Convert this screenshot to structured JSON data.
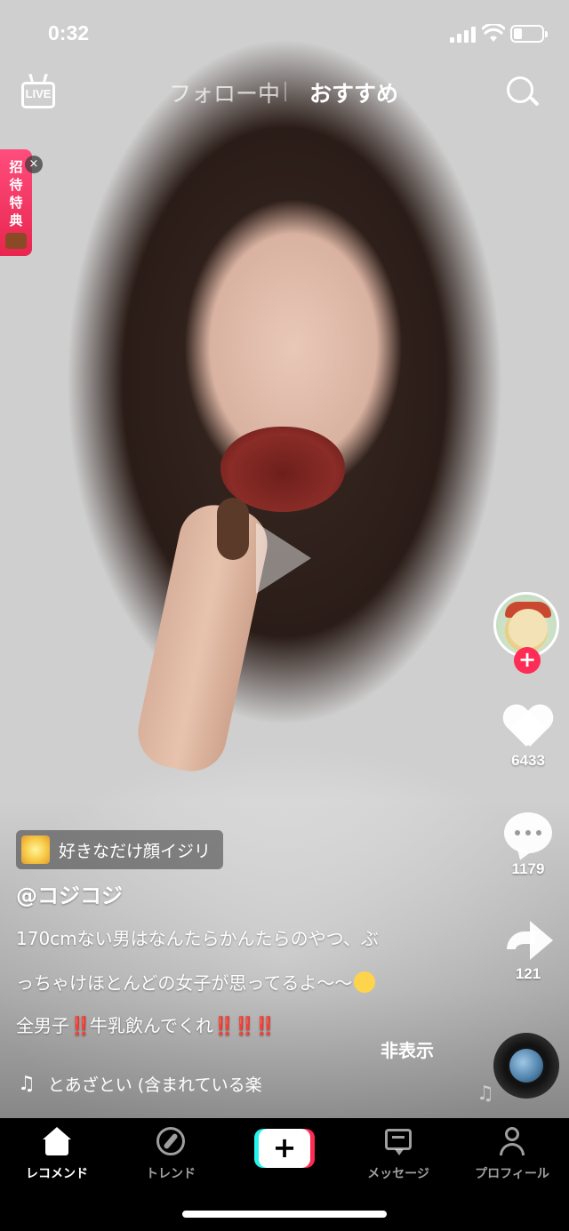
{
  "status_bar": {
    "time": "0:32",
    "battery_level": 0.3
  },
  "top_nav": {
    "live_label": "LIVE",
    "tab_following": "フォロー中",
    "tab_for_you": "おすすめ",
    "search_icon": "search-icon"
  },
  "invite_banner": {
    "text": "招待特典",
    "close_label": "×"
  },
  "actions": {
    "follow_plus": "+",
    "likes": "6433",
    "comments": "1179",
    "shares": "121"
  },
  "caption": {
    "effect_label": "好きなだけ顔イジリ",
    "username": "@コジコジ",
    "line1": "170cmない男はなんたらかんたらのやつ、ぶ",
    "line2": "っちゃけほとんどの女子が思ってるよ〜〜",
    "line3_pre": "全男子",
    "line3_bang1": "‼️",
    "line3_mid": "牛乳飲んでくれ",
    "line3_bang2": "‼️‼️‼️",
    "hide_label": "非表示",
    "music": "とあざとい (含まれている楽"
  },
  "tab_bar": {
    "home": "レコメンド",
    "discover": "トレンド",
    "create": "+",
    "inbox": "メッセージ",
    "profile": "プロフィール"
  },
  "colors": {
    "accent_red": "#fe2c55",
    "accent_cyan": "#25f4ee"
  }
}
